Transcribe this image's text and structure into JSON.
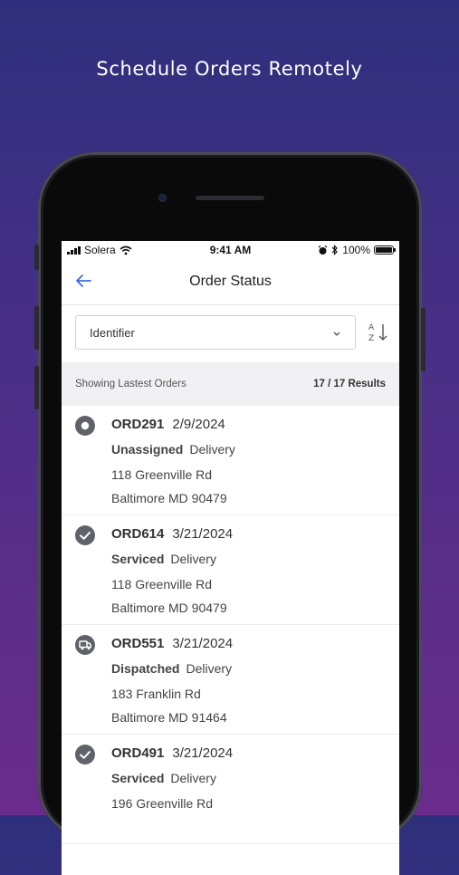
{
  "headline": "Schedule Orders Remotely",
  "statusbar": {
    "carrier": "Solera",
    "time": "9:41 AM",
    "battery": "100%"
  },
  "nav": {
    "title": "Order Status",
    "back_icon": "arrow-left-icon"
  },
  "filter": {
    "selected": "Identifier",
    "sort_icon": "sort-az-icon"
  },
  "summary": {
    "label": "Showing Lastest Orders",
    "results": "17 / 17 Results"
  },
  "orders": [
    {
      "id": "ORD291",
      "date": "2/9/2024",
      "status": "Unassigned",
      "type": "Delivery",
      "street": "118 Greenville Rd",
      "city": "Baltimore MD 90479",
      "icon": "unassigned-icon"
    },
    {
      "id": "ORD614",
      "date": "3/21/2024",
      "status": "Serviced",
      "type": "Delivery",
      "street": "118 Greenville Rd",
      "city": "Baltimore MD 90479",
      "icon": "check-icon"
    },
    {
      "id": "ORD551",
      "date": "3/21/2024",
      "status": "Dispatched",
      "type": "Delivery",
      "street": "183 Franklin Rd",
      "city": "Baltimore MD 91464",
      "icon": "truck-icon"
    },
    {
      "id": "ORD491",
      "date": "3/21/2024",
      "status": "Serviced",
      "type": "Delivery",
      "street": "196 Greenville Rd",
      "city": "",
      "icon": "check-icon"
    }
  ],
  "colors": {
    "accent": "#3b6fd8",
    "status_icon": "#5f6269",
    "bg_top": "#2e2f7c",
    "bg_bottom": "#6a2c8c"
  }
}
